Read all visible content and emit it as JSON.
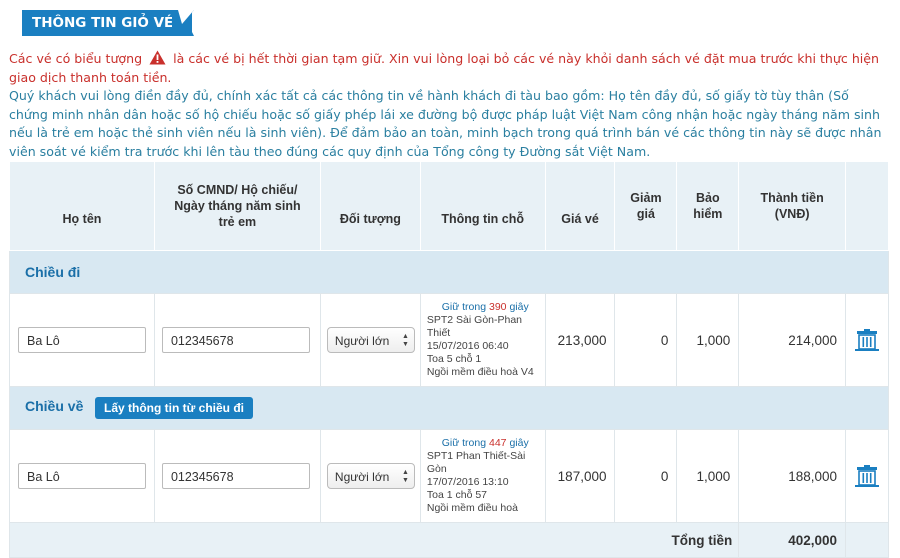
{
  "header": {
    "title": "THÔNG TIN GIỎ VÉ"
  },
  "notice": {
    "warning_before": "Các vé có biểu tượng",
    "warning_after": "là các vé bị hết thời gian tạm giữ. Xin vui lòng loại bỏ các vé này khỏi danh sách vé đặt mua trước khi thực hiện giao dịch thanh toán tiền.",
    "info": "Quý khách vui lòng điền đầy đủ, chính xác tất cả các thông tin về hành khách đi tàu bao gồm: Họ tên đầy đủ, số giấy tờ tùy thân (Số chứng minh nhân dân hoặc số hộ chiếu hoặc số giấy phép lái xe đường bộ được pháp luật Việt Nam công nhận hoặc ngày tháng năm sinh nếu là trẻ em hoặc thẻ sinh viên nếu là sinh viên). Để đảm bảo an toàn, minh bạch trong quá trình bán vé các thông tin này sẽ được nhân viên soát vé kiểm tra trước khi lên tàu theo đúng các quy định của Tổng công ty Đường sắt Việt Nam."
  },
  "columns": {
    "name": "Họ tên",
    "id_line1": "Số CMND/ Hộ chiếu/",
    "id_line2": "Ngày tháng năm sinh",
    "id_line3": "trẻ em",
    "passenger_type": "Đối tượng",
    "seat_info": "Thông tin chỗ",
    "price": "Giá vé",
    "discount_line1": "Giảm",
    "discount_line2": "giá",
    "insurance_line1": "Bảo",
    "insurance_line2": "hiểm",
    "total_line1": "Thành tiền",
    "total_line2": "(VNĐ)"
  },
  "outbound": {
    "label": "Chiều đi",
    "ticket": {
      "name": "Ba Lô",
      "id_number": "012345678",
      "passenger_type": "Người lớn",
      "hold_prefix": "Giữ trong",
      "hold_seconds": "390",
      "hold_suffix": "giây",
      "train_route_1": "SPT2 Sài Gòn-Phan",
      "train_route_2": "Thiết",
      "datetime": "15/07/2016 06:40",
      "car_seat": "Toa 5 chỗ 1",
      "seat_type": "Ngồi mềm điều hoà V4",
      "price": "213,000",
      "discount": "0",
      "insurance": "1,000",
      "total": "214,000"
    }
  },
  "return": {
    "label": "Chiều về",
    "copy_button": "Lấy thông tin từ chiều đi",
    "ticket": {
      "name": "Ba Lô",
      "id_number": "012345678",
      "passenger_type": "Người lớn",
      "hold_prefix": "Giữ trong",
      "hold_seconds": "447",
      "hold_suffix": "giây",
      "train_route_1": "SPT1 Phan Thiết-Sài",
      "train_route_2": "Gòn",
      "datetime": "17/07/2016 13:10",
      "car_seat": "Toa 1 chỗ 57",
      "seat_type": "Ngồi mềm điều hoà",
      "price": "187,000",
      "discount": "0",
      "insurance": "1,000",
      "total": "188,000"
    }
  },
  "summary": {
    "label": "Tổng tiền",
    "total": "402,000"
  },
  "icons": {
    "warning": "warning-triangle-icon",
    "delete": "trash-icon"
  },
  "colors": {
    "brand": "#1a7fc1",
    "warning": "#c9302c",
    "info": "#2a7fa0"
  }
}
